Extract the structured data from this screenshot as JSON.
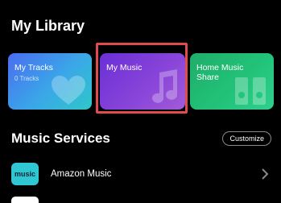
{
  "library": {
    "title": "My Library",
    "cards": [
      {
        "title": "My Tracks",
        "subtitle": "0 Tracks",
        "icon": "heart-icon"
      },
      {
        "title": "My Music",
        "subtitle": "",
        "icon": "music-note-icon"
      },
      {
        "title": "Home Music Share",
        "subtitle": "",
        "icon": "speaker-icon"
      }
    ]
  },
  "services": {
    "title": "Music Services",
    "customize_label": "Customize",
    "items": [
      {
        "name": "Amazon Music",
        "logo_text": "music",
        "icon": "chevron-right-icon"
      }
    ]
  },
  "colors": {
    "background": "#000000",
    "tracks_card": "#3aa7e8",
    "music_card": "#7b3ddb",
    "home_card": "#22c37a",
    "highlight": "#e04b4b",
    "amazon_logo": "#2fc7d1"
  }
}
